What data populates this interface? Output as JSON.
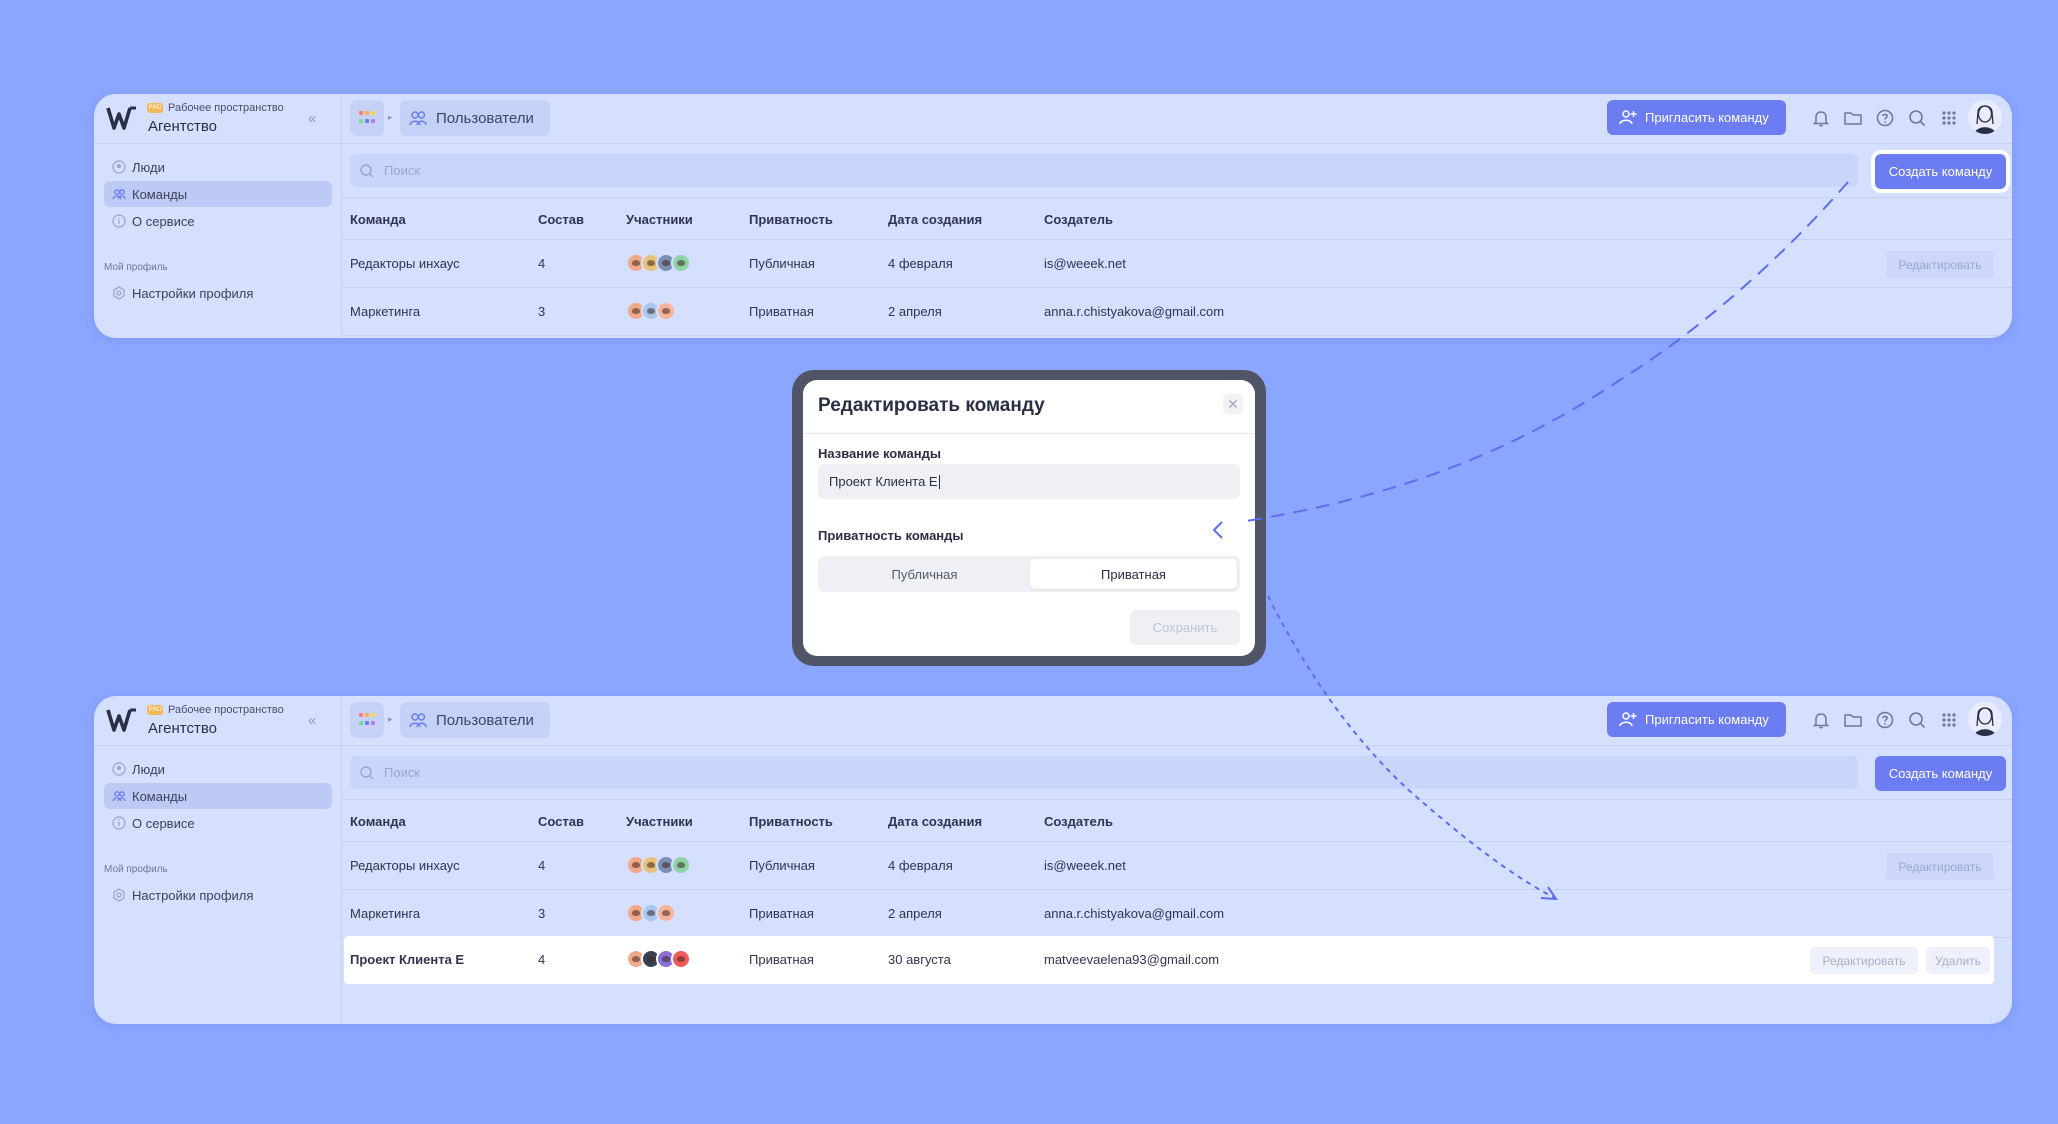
{
  "workspace": {
    "badge": "PRO",
    "label": "Рабочее пространство",
    "name": "Агентство"
  },
  "sidebar": {
    "items": [
      {
        "label": "Люди"
      },
      {
        "label": "Команды"
      },
      {
        "label": "О сервисе"
      }
    ],
    "section": "Мой профиль",
    "profile_item": "Настройки профиля"
  },
  "topbar": {
    "breadcrumb": "Пользователи",
    "invite": "Пригласить команду"
  },
  "search": {
    "placeholder": "Поиск"
  },
  "create_button": "Создать команду",
  "table": {
    "headers": [
      "Команда",
      "Состав",
      "Участники",
      "Приватность",
      "Дата создания",
      "Создатель"
    ],
    "rows": [
      {
        "name": "Редакторы инхаус",
        "size": "4",
        "privacy": "Публичная",
        "date": "4 февраля",
        "creator": "is@weeek.net",
        "edit": "Редактировать"
      },
      {
        "name": "Маркетинга",
        "size": "3",
        "privacy": "Приватная",
        "date": "2 апреля",
        "creator": "anna.r.chistyakova@gmail.com"
      },
      {
        "name": "Проект Клиента Е",
        "size": "4",
        "privacy": "Приватная",
        "date": "30 августа",
        "creator": "matveevaelena93@gmail.com",
        "edit": "Редактировать",
        "delete": "Удалить"
      }
    ]
  },
  "modal": {
    "title": "Редактировать команду",
    "name_label": "Название команды",
    "name_value": "Проект Клиента Е",
    "privacy_label": "Приватность команды",
    "options": [
      "Публичная",
      "Приватная"
    ],
    "selected_option": "Приватная",
    "save": "Сохранить"
  },
  "colors": {
    "accent": "#6c7df2",
    "background": "#8ba6ff",
    "panel": "#d5dfff"
  },
  "icons": [
    "weeek-logo-icon",
    "collapse-icon",
    "user-icon",
    "team-icon",
    "info-icon",
    "settings-icon",
    "apps-grid-icon",
    "users-icon",
    "user-plus-icon",
    "bell-icon",
    "folder-icon",
    "help-icon",
    "search-icon",
    "grid-dots-icon",
    "close-icon"
  ]
}
